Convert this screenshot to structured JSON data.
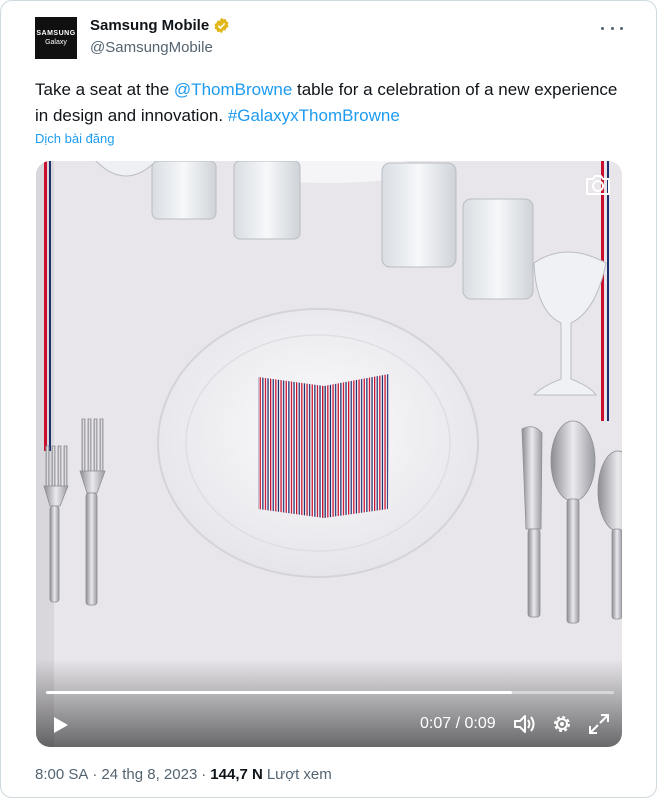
{
  "author": {
    "avatar_line1": "SAMSUNG",
    "avatar_line2": "Galaxy",
    "name": "Samsung Mobile",
    "handle": "@SamsungMobile"
  },
  "tweet": {
    "text_a": "Take a seat at the ",
    "mention": "@ThomBrowne",
    "text_b": " table for a celebration of a new experience in design and innovation. ",
    "hashtag": "#GalaxyxThomBrowne",
    "translate_label": "Dịch bài đăng"
  },
  "video": {
    "current_time": "0:07",
    "separator": " / ",
    "total_time": "0:09",
    "progress": 0.82
  },
  "meta": {
    "time": "8:00 SA",
    "dot": "·",
    "date": "24 thg 8, 2023",
    "views_count": "144,7 N",
    "views_label": "Lượt xem"
  },
  "colors": {
    "link": "#1d9bf0",
    "verified": "#e2b719",
    "stripe_red": "#c8102e",
    "stripe_blue": "#1c2f6e"
  },
  "icons": [
    "more-icon",
    "verified-badge-icon",
    "camera-icon",
    "play-icon",
    "volume-icon",
    "settings-gear-icon",
    "fullscreen-icon"
  ]
}
